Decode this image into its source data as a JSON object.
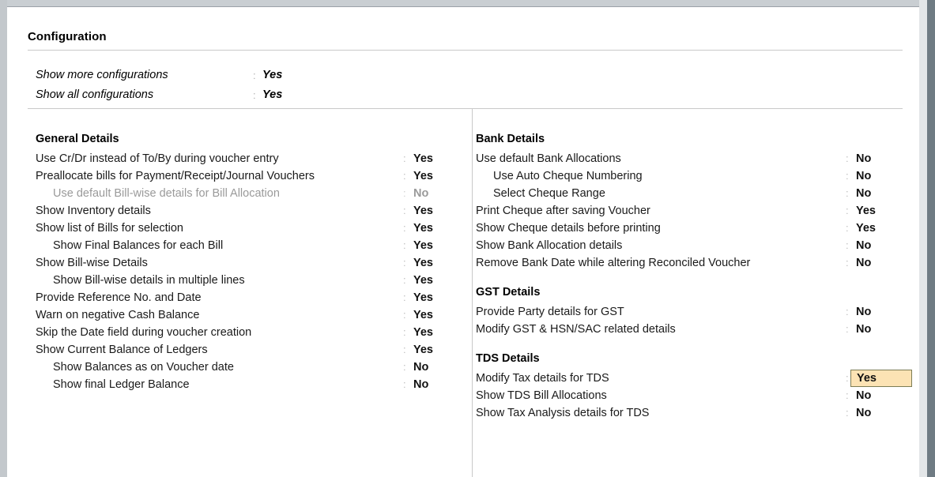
{
  "page": {
    "title": "Configuration"
  },
  "top_options": [
    {
      "label": "Show more configurations",
      "colon": ":",
      "value": "Yes"
    },
    {
      "label": "Show all configurations",
      "colon": ":",
      "value": "Yes"
    }
  ],
  "left_column": {
    "sections": [
      {
        "heading": "General Details",
        "rows": [
          {
            "label": "Use Cr/Dr instead of To/By during voucher entry",
            "colon": ":",
            "value": "Yes",
            "indent": 0,
            "disabled": false,
            "highlight": false
          },
          {
            "label": "Preallocate bills for Payment/Receipt/Journal Vouchers",
            "colon": ":",
            "value": "Yes",
            "indent": 0,
            "disabled": false,
            "highlight": false
          },
          {
            "label": "Use default Bill-wise details for Bill Allocation",
            "colon": ":",
            "value": "No",
            "indent": 1,
            "disabled": true,
            "highlight": false
          },
          {
            "label": "Show Inventory details",
            "colon": ":",
            "value": "Yes",
            "indent": 0,
            "disabled": false,
            "highlight": false
          },
          {
            "label": "Show list of Bills for selection",
            "colon": ":",
            "value": "Yes",
            "indent": 0,
            "disabled": false,
            "highlight": false
          },
          {
            "label": "Show Final Balances for each Bill",
            "colon": ":",
            "value": "Yes",
            "indent": 1,
            "disabled": false,
            "highlight": false
          },
          {
            "label": "Show Bill-wise Details",
            "colon": ":",
            "value": "Yes",
            "indent": 0,
            "disabled": false,
            "highlight": false
          },
          {
            "label": "Show Bill-wise details in multiple lines",
            "colon": ":",
            "value": "Yes",
            "indent": 1,
            "disabled": false,
            "highlight": false
          },
          {
            "label": "Provide Reference No. and Date",
            "colon": ":",
            "value": "Yes",
            "indent": 0,
            "disabled": false,
            "highlight": false
          },
          {
            "label": "Warn on negative Cash Balance",
            "colon": ":",
            "value": "Yes",
            "indent": 0,
            "disabled": false,
            "highlight": false
          },
          {
            "label": "Skip the Date field during voucher creation",
            "colon": ":",
            "value": "Yes",
            "indent": 0,
            "disabled": false,
            "highlight": false
          },
          {
            "label": "Show Current Balance of Ledgers",
            "colon": ":",
            "value": "Yes",
            "indent": 0,
            "disabled": false,
            "highlight": false
          },
          {
            "label": "Show Balances as on Voucher date",
            "colon": ":",
            "value": "No",
            "indent": 1,
            "disabled": false,
            "highlight": false
          },
          {
            "label": "Show final Ledger Balance",
            "colon": ":",
            "value": "No",
            "indent": 1,
            "disabled": false,
            "highlight": false
          }
        ]
      }
    ]
  },
  "right_column": {
    "sections": [
      {
        "heading": "Bank Details",
        "rows": [
          {
            "label": "Use default Bank Allocations",
            "colon": ":",
            "value": "No",
            "indent": 0,
            "disabled": false,
            "highlight": false
          },
          {
            "label": "Use Auto Cheque Numbering",
            "colon": ":",
            "value": "No",
            "indent": 1,
            "disabled": false,
            "highlight": false
          },
          {
            "label": "Select Cheque Range",
            "colon": ":",
            "value": "No",
            "indent": 1,
            "disabled": false,
            "highlight": false
          },
          {
            "label": "Print Cheque after saving Voucher",
            "colon": ":",
            "value": "Yes",
            "indent": 0,
            "disabled": false,
            "highlight": false
          },
          {
            "label": "Show Cheque details before printing",
            "colon": ":",
            "value": "Yes",
            "indent": 0,
            "disabled": false,
            "highlight": false
          },
          {
            "label": "Show Bank Allocation details",
            "colon": ":",
            "value": "No",
            "indent": 0,
            "disabled": false,
            "highlight": false
          },
          {
            "label": "Remove Bank Date while altering Reconciled Voucher",
            "colon": ":",
            "value": "No",
            "indent": 0,
            "disabled": false,
            "highlight": false
          }
        ]
      },
      {
        "heading": "GST Details",
        "rows": [
          {
            "label": "Provide Party details for GST",
            "colon": ":",
            "value": "No",
            "indent": 0,
            "disabled": false,
            "highlight": false
          },
          {
            "label": "Modify GST & HSN/SAC related details",
            "colon": ":",
            "value": "No",
            "indent": 0,
            "disabled": false,
            "highlight": false
          }
        ]
      },
      {
        "heading": "TDS Details",
        "rows": [
          {
            "label": "Modify Tax details for TDS",
            "colon": ":",
            "value": "Yes",
            "indent": 0,
            "disabled": false,
            "highlight": true
          },
          {
            "label": "Show TDS Bill Allocations",
            "colon": ":",
            "value": "No",
            "indent": 0,
            "disabled": false,
            "highlight": false
          },
          {
            "label": "Show Tax Analysis details for TDS",
            "colon": ":",
            "value": "No",
            "indent": 0,
            "disabled": false,
            "highlight": false
          }
        ]
      }
    ]
  },
  "colors": {
    "highlight_background": "#fce3b4",
    "highlight_border": "#7d7d55",
    "rule": "#c9c9c9",
    "disabled_text": "#9a9a9a",
    "frame": "#c3c8cc"
  }
}
